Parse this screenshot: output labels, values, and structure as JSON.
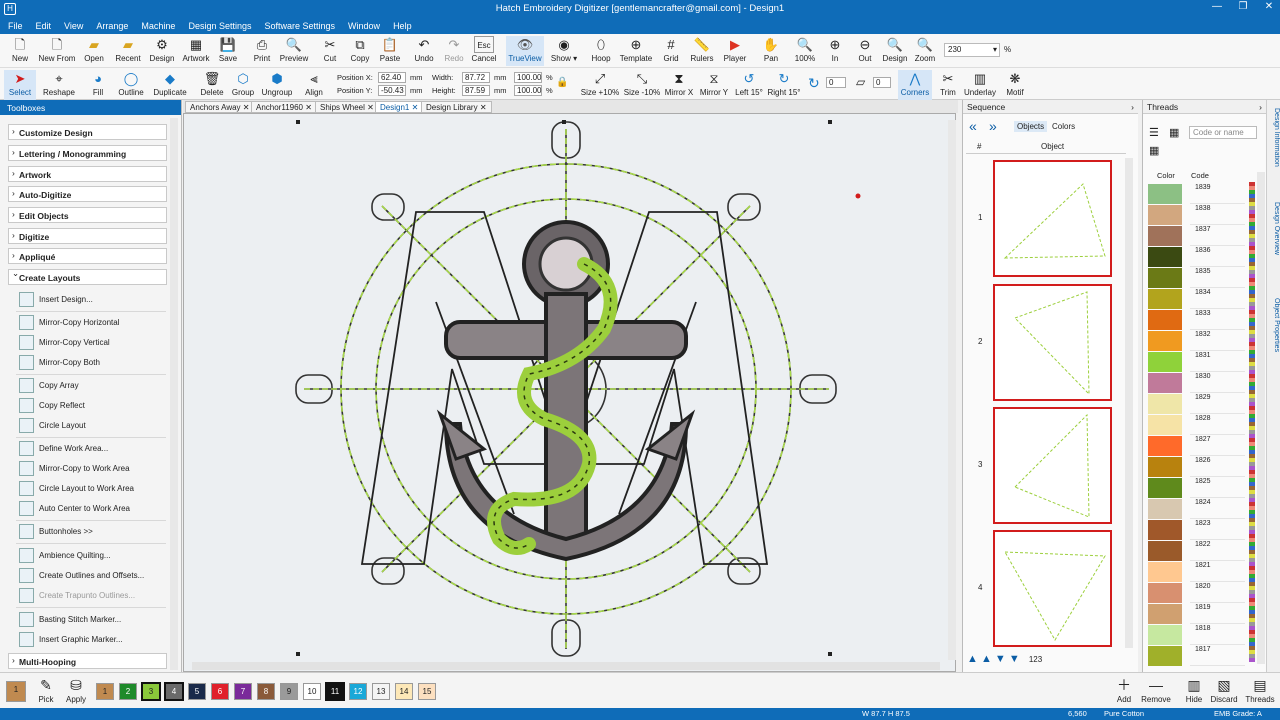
{
  "window": {
    "title": "Hatch Embroidery Digitizer [gentlemancrafter@gmail.com] - Design1"
  },
  "menu": [
    "File",
    "Edit",
    "View",
    "Arrange",
    "Machine",
    "Design Settings",
    "Software Settings",
    "Window",
    "Help"
  ],
  "toolbar1": [
    "New",
    "New From",
    "Open",
    "Recent",
    "Design",
    "Artwork",
    "Save",
    "Print",
    "Preview",
    "Cut",
    "Copy",
    "Paste",
    "Undo",
    "Redo",
    "Cancel",
    "TrueView",
    "Show",
    "Hoop",
    "Template",
    "Grid",
    "Rulers",
    "Player",
    "Pan",
    "100%",
    "In",
    "Out",
    "Design",
    "Zoom"
  ],
  "zoom": {
    "value": "230",
    "unit": "%"
  },
  "toolbar2": [
    "Select",
    "Reshape",
    "Fill",
    "Outline",
    "Duplicate",
    "Delete",
    "Group",
    "Ungroup",
    "Align"
  ],
  "toolbar2b": [
    "Size +10%",
    "Size -10%",
    "Mirror X",
    "Mirror Y",
    "Left 15°",
    "Right 15°",
    "Corners",
    "Trim",
    "Underlay",
    "Motif"
  ],
  "position": {
    "x_label": "Position X:",
    "y_label": "Position Y:",
    "x": "62.40",
    "y": "-50.43",
    "unit": "mm",
    "width_label": "Width:",
    "height_label": "Height:",
    "width": "87.72",
    "height": "87.59",
    "sx": "100.00",
    "sy": "100.00",
    "pct": "%",
    "rot": "0",
    "skew": "0"
  },
  "toolboxes": {
    "title": "Toolboxes",
    "sections": [
      "Customize Design",
      "Lettering / Monogramming",
      "Artwork",
      "Auto-Digitize",
      "Edit Objects",
      "Digitize",
      "Appliqué",
      "Create Layouts"
    ],
    "tools": [
      "Insert Design...",
      "Mirror-Copy Horizontal",
      "Mirror-Copy Vertical",
      "Mirror-Copy Both",
      "Copy Array",
      "Copy Reflect",
      "Circle Layout",
      "Define Work Area...",
      "Mirror-Copy to Work Area",
      "Circle Layout to Work Area",
      "Auto Center to Work Area",
      "Buttonholes >>",
      "Ambience Quilting...",
      "Create Outlines and Offsets...",
      "Create Trapunto Outlines...",
      "Basting Stitch Marker...",
      "Insert Graphic Marker..."
    ],
    "last": "Multi-Hooping"
  },
  "tabs": [
    "Anchors Away",
    "Anchor11960",
    "Ships Wheel",
    "Design1",
    "Design Library"
  ],
  "sequence": {
    "title": "Sequence",
    "tab_objects": "Objects",
    "tab_colors": "Colors",
    "col_num": "#",
    "col_obj": "Object",
    "rows": [
      "1",
      "2",
      "3",
      "4"
    ],
    "count_label": "123"
  },
  "threads": {
    "title": "Threads",
    "placeholder": "Code or name",
    "col_color": "Color",
    "col_code": "Code",
    "rows": [
      {
        "code": "1839",
        "color": "#8cc084"
      },
      {
        "code": "1838",
        "color": "#d2a77f"
      },
      {
        "code": "1837",
        "color": "#a0725a"
      },
      {
        "code": "1836",
        "color": "#3b4a12"
      },
      {
        "code": "1835",
        "color": "#6b7a16"
      },
      {
        "code": "1834",
        "color": "#b2a41d"
      },
      {
        "code": "1833",
        "color": "#e06a12"
      },
      {
        "code": "1832",
        "color": "#f09a20"
      },
      {
        "code": "1831",
        "color": "#8fd23a"
      },
      {
        "code": "1830",
        "color": "#c07a9a"
      },
      {
        "code": "1829",
        "color": "#efe6a8"
      },
      {
        "code": "1828",
        "color": "#f6e3a6"
      },
      {
        "code": "1827",
        "color": "#ff6a2a"
      },
      {
        "code": "1826",
        "color": "#b8820e"
      },
      {
        "code": "1825",
        "color": "#5f8a1c"
      },
      {
        "code": "1824",
        "color": "#d8c8b0"
      },
      {
        "code": "1823",
        "color": "#a0582a"
      },
      {
        "code": "1822",
        "color": "#9a5a2a"
      },
      {
        "code": "1821",
        "color": "#ffc890"
      },
      {
        "code": "1820",
        "color": "#d89070"
      },
      {
        "code": "1819",
        "color": "#d0a070"
      },
      {
        "code": "1818",
        "color": "#c6e8a0"
      },
      {
        "code": "1817",
        "color": "#a0b02a"
      }
    ]
  },
  "right_tabs": [
    "Design Information",
    "Design Overview",
    "Object Properties"
  ],
  "colorbar": {
    "pick": "Pick",
    "apply": "Apply",
    "current": "1",
    "chips": [
      {
        "n": "1",
        "color": "#c08a50"
      },
      {
        "n": "2",
        "color": "#1e8a2a"
      },
      {
        "n": "3",
        "color": "#8ac83a"
      },
      {
        "n": "4",
        "color": "#6a6a6a"
      },
      {
        "n": "5",
        "color": "#1a2a4a"
      },
      {
        "n": "6",
        "color": "#e0202a"
      },
      {
        "n": "7",
        "color": "#7a2a9a"
      },
      {
        "n": "8",
        "color": "#8a5a3a"
      },
      {
        "n": "9",
        "color": "#9a9a9a"
      },
      {
        "n": "10",
        "color": "#ffffff"
      },
      {
        "n": "11",
        "color": "#111111"
      },
      {
        "n": "12",
        "color": "#1aa8d8"
      },
      {
        "n": "13",
        "color": "#f4f4f4"
      },
      {
        "n": "14",
        "color": "#fde8b8"
      },
      {
        "n": "15",
        "color": "#fde0c0"
      }
    ],
    "buttons": [
      "Add",
      "Remove",
      "Hide",
      "Discard",
      "Threads"
    ]
  },
  "status": {
    "dims": "W 87.7 H 87.5",
    "stitches": "6,560",
    "fabric": "Pure Cotton",
    "grade": "EMB Grade: A"
  },
  "colors": {
    "accent": "#0f6cb8",
    "rope": "#a8d84a",
    "anchor": "#8a8386",
    "select_red": "#d21c1c"
  }
}
